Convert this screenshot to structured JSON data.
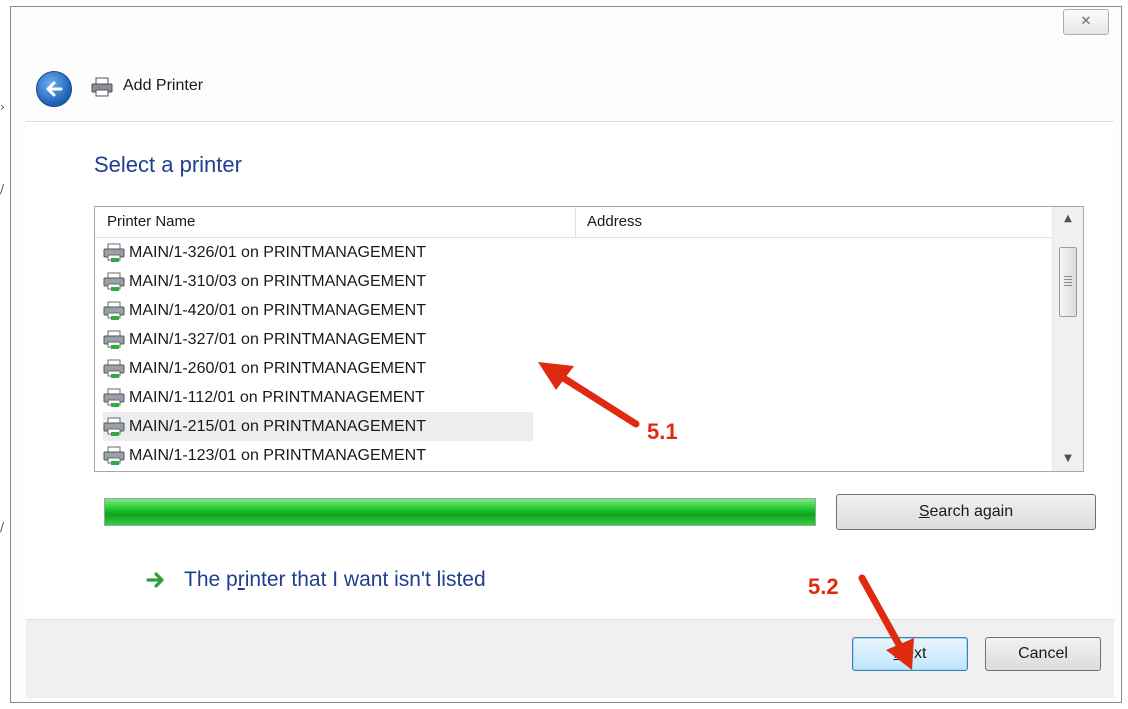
{
  "window": {
    "title": "Add Printer",
    "close_glyph": "✕",
    "back_icon": "back-arrow-icon"
  },
  "page": {
    "heading": "Select a printer"
  },
  "printer_list": {
    "columns": [
      "Printer Name",
      "Address"
    ],
    "rows": [
      "MAIN/1-326/01 on PRINTMANAGEMENT",
      "MAIN/1-310/03 on PRINTMANAGEMENT",
      "MAIN/1-420/01 on PRINTMANAGEMENT",
      "MAIN/1-327/01 on PRINTMANAGEMENT",
      "MAIN/1-260/01 on PRINTMANAGEMENT",
      "MAIN/1-112/01 on PRINTMANAGEMENT",
      "MAIN/1-215/01 on PRINTMANAGEMENT",
      "MAIN/1-123/01 on PRINTMANAGEMENT"
    ],
    "highlighted_row": "MAIN/1-215/01 on PRINTMANAGEMENT",
    "row_icon": "printer-icon",
    "scroll_up_glyph": "▲",
    "scroll_down_glyph": "▼"
  },
  "search": {
    "progress_fraction": 1.0,
    "progress_color": "#1cc52c",
    "button_pre": "",
    "button_key": "S",
    "button_post": "earch again"
  },
  "not_listed_link": {
    "pre": "The p",
    "key": "r",
    "post": "inter that I want isn't listed"
  },
  "footer": {
    "next_key": "N",
    "next_post": "ext",
    "cancel_label": "Cancel"
  },
  "annotations": {
    "step_a": "5.1",
    "step_b": "5.2",
    "color": "#e02a10"
  }
}
